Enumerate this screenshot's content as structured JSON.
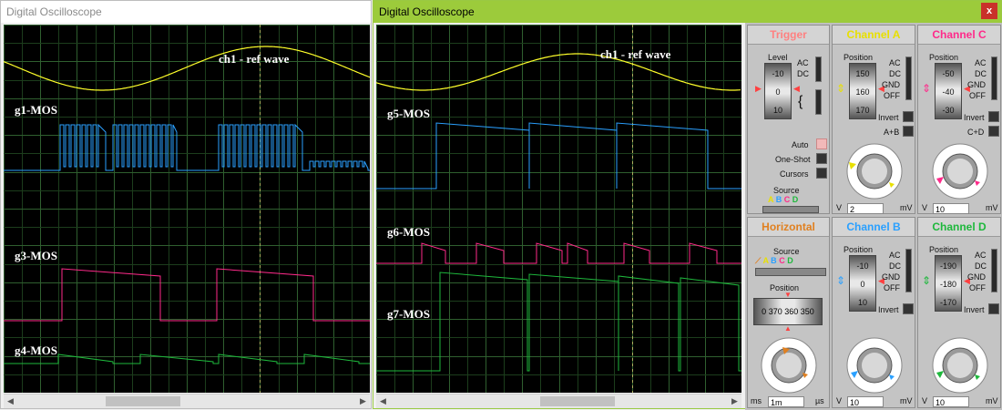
{
  "left_window": {
    "title": "Digital Oscilloscope",
    "labels": {
      "ref": "ch1 - ref wave",
      "g1": "g1-MOS",
      "g3": "g3-MOS",
      "g4": "g4-MOS"
    }
  },
  "right_window": {
    "title": "Digital Oscilloscope",
    "close_glyph": "x",
    "labels": {
      "ref": "ch1 - ref wave",
      "g5": "g5-MOS",
      "g6": "g6-MOS",
      "g7": "g7-MOS"
    }
  },
  "colors": {
    "chA": "#ffff2a",
    "chB": "#2aa0ff",
    "chC": "#ff2a8a",
    "chD": "#1eb83c",
    "trigger": "#ff8080",
    "horizontal": "#e08020"
  },
  "panel": {
    "trigger": {
      "title": "Trigger",
      "level_label": "Level",
      "level_ticks": [
        "-10",
        "0",
        "10"
      ],
      "ac": "AC",
      "dc": "DC",
      "auto": "Auto",
      "one_shot": "One-Shot",
      "cursors": "Cursors",
      "source_label": "Source",
      "source_letters": [
        "A",
        "B",
        "C",
        "D"
      ]
    },
    "channel_a": {
      "title": "Channel A",
      "position_label": "Position",
      "ticks": [
        "150",
        "160",
        "170"
      ],
      "modes": [
        "AC",
        "DC",
        "GND",
        "OFF"
      ],
      "invert": "Invert",
      "combine": "A+B",
      "dial_labels": [
        "0.5",
        "0.2",
        "0.1",
        "1",
        "50",
        "2",
        "20",
        "5",
        "10",
        "10",
        "5",
        "20",
        "2"
      ],
      "unit_left": "V",
      "value": "2",
      "unit_right": "mV"
    },
    "channel_c": {
      "title": "Channel C",
      "position_label": "Position",
      "ticks": [
        "-50",
        "-40",
        "-30"
      ],
      "modes": [
        "AC",
        "DC",
        "GND",
        "OFF"
      ],
      "invert": "Invert",
      "combine": "C+D",
      "unit_left": "V",
      "value": "10",
      "unit_right": "mV"
    },
    "horizontal": {
      "title": "Horizontal",
      "source_label": "Source",
      "source_letters": [
        "A",
        "B",
        "C",
        "D"
      ],
      "position_label": "Position",
      "ticks": [
        "0",
        "370",
        "360",
        "350"
      ],
      "dial_labels": [
        "0.5",
        "0.2",
        "0.1",
        "50",
        "100",
        "20",
        "10",
        "200",
        "5"
      ],
      "unit_left": "ms",
      "value": "1m",
      "unit_right": "µs"
    },
    "channel_b": {
      "title": "Channel B",
      "position_label": "Position",
      "ticks": [
        "-10",
        "0",
        "10"
      ],
      "modes": [
        "AC",
        "DC",
        "GND",
        "OFF"
      ],
      "invert": "Invert",
      "unit_left": "V",
      "value": "10",
      "unit_right": "mV"
    },
    "channel_d": {
      "title": "Channel D",
      "position_label": "Position",
      "ticks": [
        "-190",
        "-180",
        "-170"
      ],
      "modes": [
        "AC",
        "DC",
        "GND",
        "OFF"
      ],
      "invert": "Invert",
      "unit_left": "V",
      "value": "10",
      "unit_right": "mV"
    }
  }
}
